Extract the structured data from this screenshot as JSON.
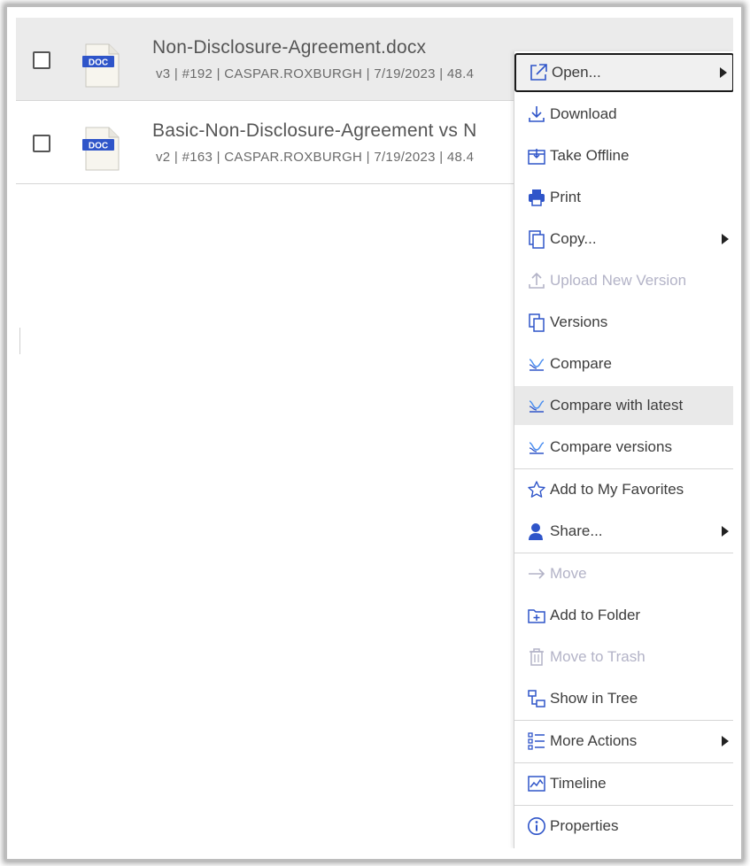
{
  "files": [
    {
      "name": "Non-Disclosure-Agreement.docx",
      "meta": "v3 | #192 | CASPAR.ROXBURGH | 7/19/2023 | 48.4",
      "icon_label": "DOC",
      "selected": true
    },
    {
      "name": "Basic-Non-Disclosure-Agreement vs N",
      "meta": "v2 | #163 | CASPAR.ROXBURGH | 7/19/2023 | 48.4",
      "icon_label": "DOC",
      "selected": false
    }
  ],
  "context_menu": {
    "items": [
      {
        "label": "Open...",
        "icon": "open-external-icon",
        "submenu": true,
        "state": "focused"
      },
      {
        "label": "Download",
        "icon": "download-icon"
      },
      {
        "label": "Take Offline",
        "icon": "take-offline-icon"
      },
      {
        "label": "Print",
        "icon": "printer-icon"
      },
      {
        "label": "Copy...",
        "icon": "copy-icon",
        "submenu": true
      },
      {
        "label": "Upload New Version",
        "icon": "upload-icon",
        "disabled": true
      },
      {
        "label": "Versions",
        "icon": "versions-icon"
      },
      {
        "label": "Compare",
        "icon": "compare-icon"
      },
      {
        "label": "Compare with latest",
        "icon": "compare-icon",
        "state": "hovered"
      },
      {
        "label": "Compare versions",
        "icon": "compare-icon"
      },
      {
        "label": "Add to My Favorites",
        "icon": "star-icon"
      },
      {
        "label": "Share...",
        "icon": "share-person-icon",
        "submenu": true
      },
      {
        "label": "Move",
        "icon": "arrow-right-icon",
        "disabled": true
      },
      {
        "label": "Add to Folder",
        "icon": "add-folder-icon"
      },
      {
        "label": "Move to Trash",
        "icon": "trash-icon",
        "disabled": true
      },
      {
        "label": "Show in Tree",
        "icon": "tree-icon"
      },
      {
        "label": "More Actions",
        "icon": "list-icon",
        "submenu": true
      },
      {
        "label": "Timeline",
        "icon": "timeline-chart-icon"
      },
      {
        "label": "Properties",
        "icon": "info-icon"
      }
    ]
  },
  "colors": {
    "icon_blue": "#2f55c9",
    "doc_badge": "#2f55c9",
    "disabled_text": "#b3b3c7",
    "selected_row_bg": "#ebebeb"
  }
}
